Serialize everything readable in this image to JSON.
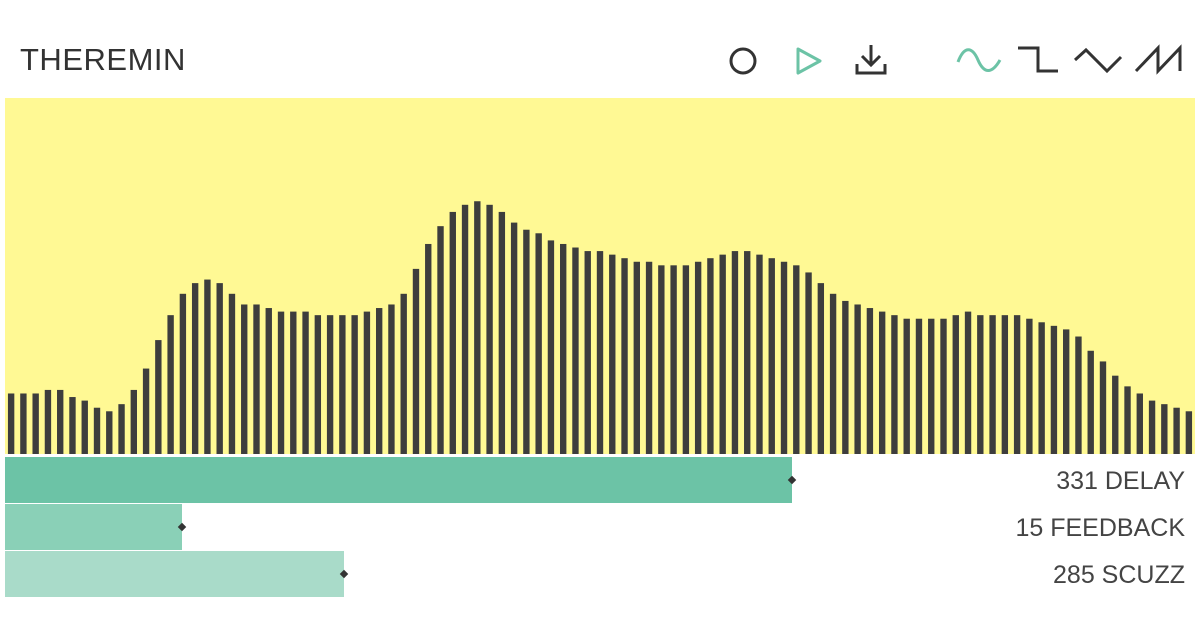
{
  "app": {
    "title": "THEREMIN"
  },
  "toolbar": {
    "buttons": [
      {
        "name": "record-icon",
        "active": false
      },
      {
        "name": "play-icon",
        "active": true
      },
      {
        "name": "download-icon",
        "active": false
      }
    ],
    "waveforms": [
      {
        "name": "sine-wave-icon",
        "active": true
      },
      {
        "name": "square-wave-icon",
        "active": false
      },
      {
        "name": "triangle-wave-icon",
        "active": false
      },
      {
        "name": "sawtooth-wave-icon",
        "active": false
      }
    ]
  },
  "colors": {
    "accent": "#6cc3a6",
    "accent_mid": "#8ad0b7",
    "accent_light": "#a9dbc9",
    "visualizer_bg": "#fff994",
    "bar": "#3d3d3d",
    "text": "#333333"
  },
  "visualizer": {
    "levels": [
      0.17,
      0.17,
      0.17,
      0.18,
      0.18,
      0.16,
      0.15,
      0.13,
      0.12,
      0.14,
      0.18,
      0.24,
      0.32,
      0.39,
      0.45,
      0.48,
      0.49,
      0.48,
      0.45,
      0.42,
      0.42,
      0.41,
      0.4,
      0.4,
      0.4,
      0.39,
      0.39,
      0.39,
      0.39,
      0.4,
      0.41,
      0.42,
      0.45,
      0.52,
      0.59,
      0.64,
      0.68,
      0.7,
      0.71,
      0.7,
      0.68,
      0.65,
      0.63,
      0.62,
      0.6,
      0.59,
      0.58,
      0.57,
      0.57,
      0.56,
      0.55,
      0.54,
      0.54,
      0.53,
      0.53,
      0.53,
      0.54,
      0.55,
      0.56,
      0.57,
      0.57,
      0.56,
      0.55,
      0.54,
      0.53,
      0.51,
      0.48,
      0.45,
      0.43,
      0.42,
      0.41,
      0.4,
      0.39,
      0.38,
      0.38,
      0.38,
      0.38,
      0.39,
      0.4,
      0.39,
      0.39,
      0.39,
      0.39,
      0.38,
      0.37,
      0.36,
      0.35,
      0.33,
      0.29,
      0.26,
      0.22,
      0.19,
      0.17,
      0.15,
      0.14,
      0.13,
      0.12
    ]
  },
  "controls": [
    {
      "key": "delay",
      "label": "331 DELAY",
      "value": 331,
      "fraction": 0.661,
      "color": "#6cc3a6"
    },
    {
      "key": "feedback",
      "label": "15 FEEDBACK",
      "value": 15,
      "fraction": 0.149,
      "color": "#8ad0b7"
    },
    {
      "key": "scuzz",
      "label": "285 SCUZZ",
      "value": 285,
      "fraction": 0.285,
      "color": "#a9dbc9"
    }
  ]
}
